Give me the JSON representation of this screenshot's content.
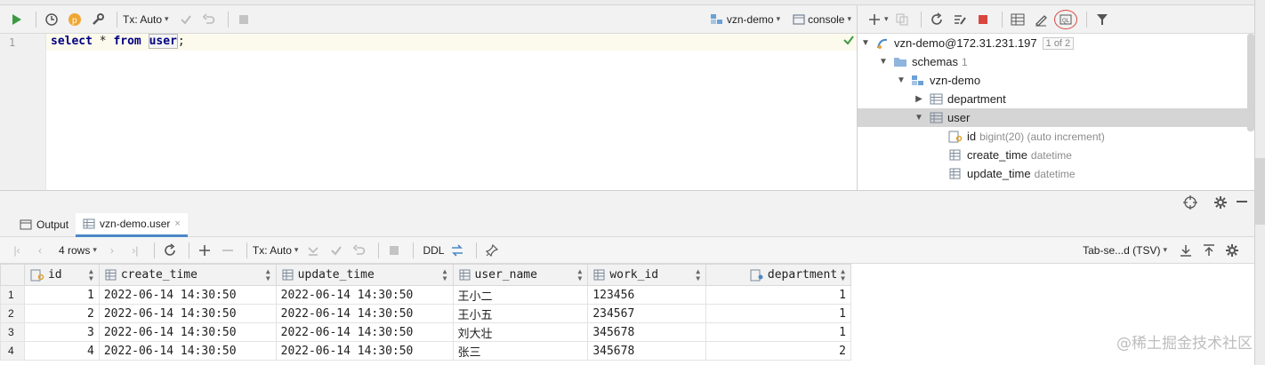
{
  "editor_toolbar": {
    "tx_mode": "Tx: Auto",
    "datasource": "vzn-demo",
    "console": "console"
  },
  "editor": {
    "line_number": "1",
    "code": {
      "kw_select": "select",
      "star": " * ",
      "kw_from": "from",
      "space": " ",
      "table": "user",
      "semicolon": ";"
    }
  },
  "db_tree": {
    "connection": "vzn-demo@172.31.231.197",
    "connection_badge": "1 of 2",
    "schemas_label": "schemas",
    "schemas_count": "1",
    "schema": "vzn-demo",
    "tables": [
      "department",
      "user"
    ],
    "columns": [
      {
        "name": "id",
        "type": "bigint(20) (auto increment)"
      },
      {
        "name": "create_time",
        "type": "datetime"
      },
      {
        "name": "update_time",
        "type": "datetime"
      }
    ]
  },
  "bottom_tabs": {
    "output": "Output",
    "result": "vzn-demo.user"
  },
  "result_toolbar": {
    "rows": "4 rows",
    "tx_mode": "Tx: Auto",
    "ddl": "DDL",
    "export_format": "Tab-se...d (TSV)"
  },
  "grid": {
    "columns": [
      "id",
      "create_time",
      "update_time",
      "user_name",
      "work_id",
      "department"
    ],
    "rows": [
      {
        "n": "1",
        "id": "1",
        "create_time": "2022-06-14 14:30:50",
        "update_time": "2022-06-14 14:30:50",
        "user_name": "王小二",
        "work_id": "123456",
        "department": "1"
      },
      {
        "n": "2",
        "id": "2",
        "create_time": "2022-06-14 14:30:50",
        "update_time": "2022-06-14 14:30:50",
        "user_name": "王小五",
        "work_id": "234567",
        "department": "1"
      },
      {
        "n": "3",
        "id": "3",
        "create_time": "2022-06-14 14:30:50",
        "update_time": "2022-06-14 14:30:50",
        "user_name": "刘大壮",
        "work_id": "345678",
        "department": "1"
      },
      {
        "n": "4",
        "id": "4",
        "create_time": "2022-06-14 14:30:50",
        "update_time": "2022-06-14 14:30:50",
        "user_name": "张三",
        "work_id": "345678",
        "department": "2"
      }
    ]
  },
  "watermark": "@稀土掘金技术社区",
  "colors": {
    "run_green": "#3c9a42",
    "stop_red": "#d9463e",
    "keyword": "#000080",
    "table_icon": "#7a8899",
    "schema_folder": "#6aa0d8",
    "tab_accent": "#4a88c7"
  }
}
